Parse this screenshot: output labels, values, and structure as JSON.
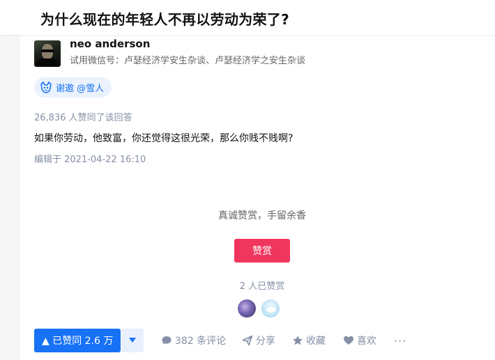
{
  "question": {
    "title": "为什么现在的年轻人不再以劳动为荣了?"
  },
  "author": {
    "name": "neo anderson",
    "headline": "试用微信号：卢瑟经济学安生杂谈、卢瑟经济学之安生杂谈",
    "avatar_icon": "neo-portrait-avatar"
  },
  "invite": {
    "label": "谢邀 @雪人",
    "icon": "invite-icon",
    "color": "#1772f6"
  },
  "answer": {
    "votes_text": "26,836 人赞同了该回答",
    "content": "如果你劳动，他致富，你还觉得这很光荣，那么你贱不贱啊?",
    "edit_time": "编辑于 2021-04-22 16:10"
  },
  "reward": {
    "prompt": "真诚赞赏，手留余香",
    "button_label": "赞赏",
    "button_color": "#f1365d",
    "count_text": "2 人已赞赏"
  },
  "actions": {
    "upvote_label": "▲ 已赞同 2.6 万",
    "downvote_icon": "triangle-down-icon",
    "comment_label": "382 条评论",
    "share_label": "分享",
    "favorite_label": "收藏",
    "like_label": "喜欢",
    "more_label": "···",
    "primary_color": "#1772f6"
  }
}
